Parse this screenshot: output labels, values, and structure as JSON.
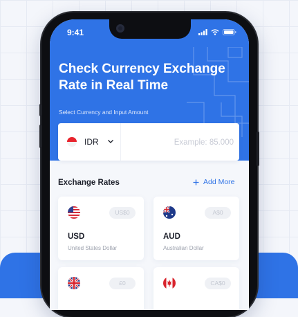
{
  "status_bar": {
    "time": "9:41"
  },
  "hero": {
    "title": "Check Currency Exchange Rate in Real Time",
    "subtitle": "Select Currency and Input Amount"
  },
  "converter": {
    "selected_currency": "IDR",
    "amount_value": "",
    "amount_placeholder": "Example: 85.000"
  },
  "exchange_rates": {
    "heading": "Exchange Rates",
    "add_more_label": "Add More",
    "cards": [
      {
        "code": "USD",
        "name": "United States Dollar",
        "value": "US$0",
        "flag_icon": "us-flag-icon"
      },
      {
        "code": "AUD",
        "name": "Australian Dollar",
        "value": "A$0",
        "flag_icon": "au-flag-icon"
      },
      {
        "code": "",
        "name": "",
        "value": "£0",
        "flag_icon": "uk-flag-icon"
      },
      {
        "code": "",
        "name": "",
        "value": "CA$0",
        "flag_icon": "ca-flag-icon"
      }
    ]
  },
  "colors": {
    "accent": "#2f73e6",
    "background": "#f5f7fb",
    "card": "#ffffff"
  }
}
